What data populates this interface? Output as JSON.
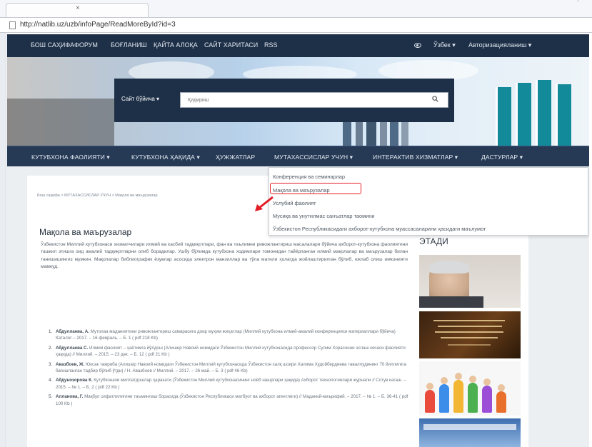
{
  "browser": {
    "tab_close": "×",
    "tray_indicator": "ˊ",
    "url": "http://natlib.uz/uzb/infoPage/ReadMoreById?id=3"
  },
  "topnav": {
    "items": [
      "БОШ САҲИФА",
      "ФОРУМ",
      "БОҒЛАНИШ",
      "ҚАЙТА АЛОҚА",
      "САЙТ ХАРИТАСИ",
      "RSS"
    ],
    "language": "Ўзбек ▾",
    "auth": "Авторизацияланиш ▾"
  },
  "search": {
    "scope": "Сайт бўйича ▾",
    "placeholder": "Қидириш"
  },
  "mainnav": {
    "items": [
      "КУТУБХОНА ФАОЛИЯТИ ▾",
      "КУТУБХОНА ҲАҚИДА ▾",
      "ҲУЖЖАТЛАР",
      "МУТАХАССИСЛАР УЧУН ▾",
      "ИНТЕРАКТИВ ХИЗМАТЛАР ▾",
      "ДАСТУРЛАР ▾"
    ]
  },
  "dropdown": {
    "items": [
      "Конференция ва семинарлар",
      "Мақола ва маърузалар",
      "Услубий фаолият",
      "Мусиқа ва унутилмас санъатлар таомини",
      "Ўзбекистон Республикасидаги ахборот-кутубхона муассасаларини ҳасидаги маълумот"
    ]
  },
  "breadcrumb": "Бош саҳифа > МУТАХАССИСЛАР УЧУН > Мақола ва маърузалар",
  "page_title": "Мақола ва маърузалар",
  "intro": "Ўзбекистон Миллий кутубхонаси хизматчилари илмий ва касбий тадқиқотлари, фан ва таълимни ривожлантириш масалалари бўйича ахборот-кутубхона фаолиятини ташкил этишга оид амалий тадқиқотларни олиб борадилар. Ушбу бўлимда кутубхона ходимлари томонидан тайёрланган илмий мақолалар ва маърузалар билан танишишингиз мумкин. Мақолалар библиографик ёзувлар асосида электрон манзиллар ва тўла матнли ҳолатда жойлаштирилган бўлиб, юклаб олиш имконияти мавжуд.",
  "references": [
    {
      "num": "1.",
      "author": "Абдуллаева, А.",
      "text": " Мутолаа маданиятини ривожлантириш самарасига доир муҳим жиҳатлар (Миллий кутубхона илмий-амалий конференцияси материаллари бўйича) Каталог – 2017. – 16 февраль. – Б. 1 ( pdf 218 Kb)"
    },
    {
      "num": "2.",
      "author": "Абдуллаева С.",
      "text": " Илмий фаолият – ҳаётимга йўлдош (Алишер Навоий номидаги Ўзбекистон Миллий кутубхонасида профессор Сулим Хорасонни эслаш кечаси фаолияти ҳақида) // Миллий. – 2015. – 23 дек. – Б. 12 ( pdf 21 Kb )"
    },
    {
      "num": "3.",
      "author": "Авазбоев, Ж.",
      "text": " Юксак тажриба (Алишер Навоий номидаги Ўзбекистон Миллий кутубхонасида Ўзбекистон халқ шоири Халима Худойбердиева таваллудининг 70 йиллигига бағишланган тадбир бўлиб ўтди) / Н. Авазбоев // Миллий. – 2017. – 26 май. – Б. 3 ( pdf 46 Kb)"
    },
    {
      "num": "4.",
      "author": "Абдунозорова К.",
      "text": " Кутубхоначи миллатдошлар ҳаракати (Ўзбекистон Миллий кутубхонасининг ноёб нашрлари ҳақида) Ахборот технологиялари журнали // Сотув кагаш. – 2015. – № 1. – Б. 2 ( pdf 22 Kb )"
    },
    {
      "num": "5.",
      "author": "Алланова, Г.",
      "text": " Мақбул сифатлилигини таъминлаш борасида (Ўзбекистон Республикаси матбуот ва ахборот агентлиги) // Маданий-маърифий. – 2017. – № 1. – Б. 36-41 ( pdf 100 Kb )"
    }
  ],
  "sidebar": {
    "title": "ЭТАДИ"
  },
  "colors": {
    "topnav_bg": "#1e3048",
    "mainnav_bg": "#263a55",
    "highlight": "#e21d24"
  }
}
